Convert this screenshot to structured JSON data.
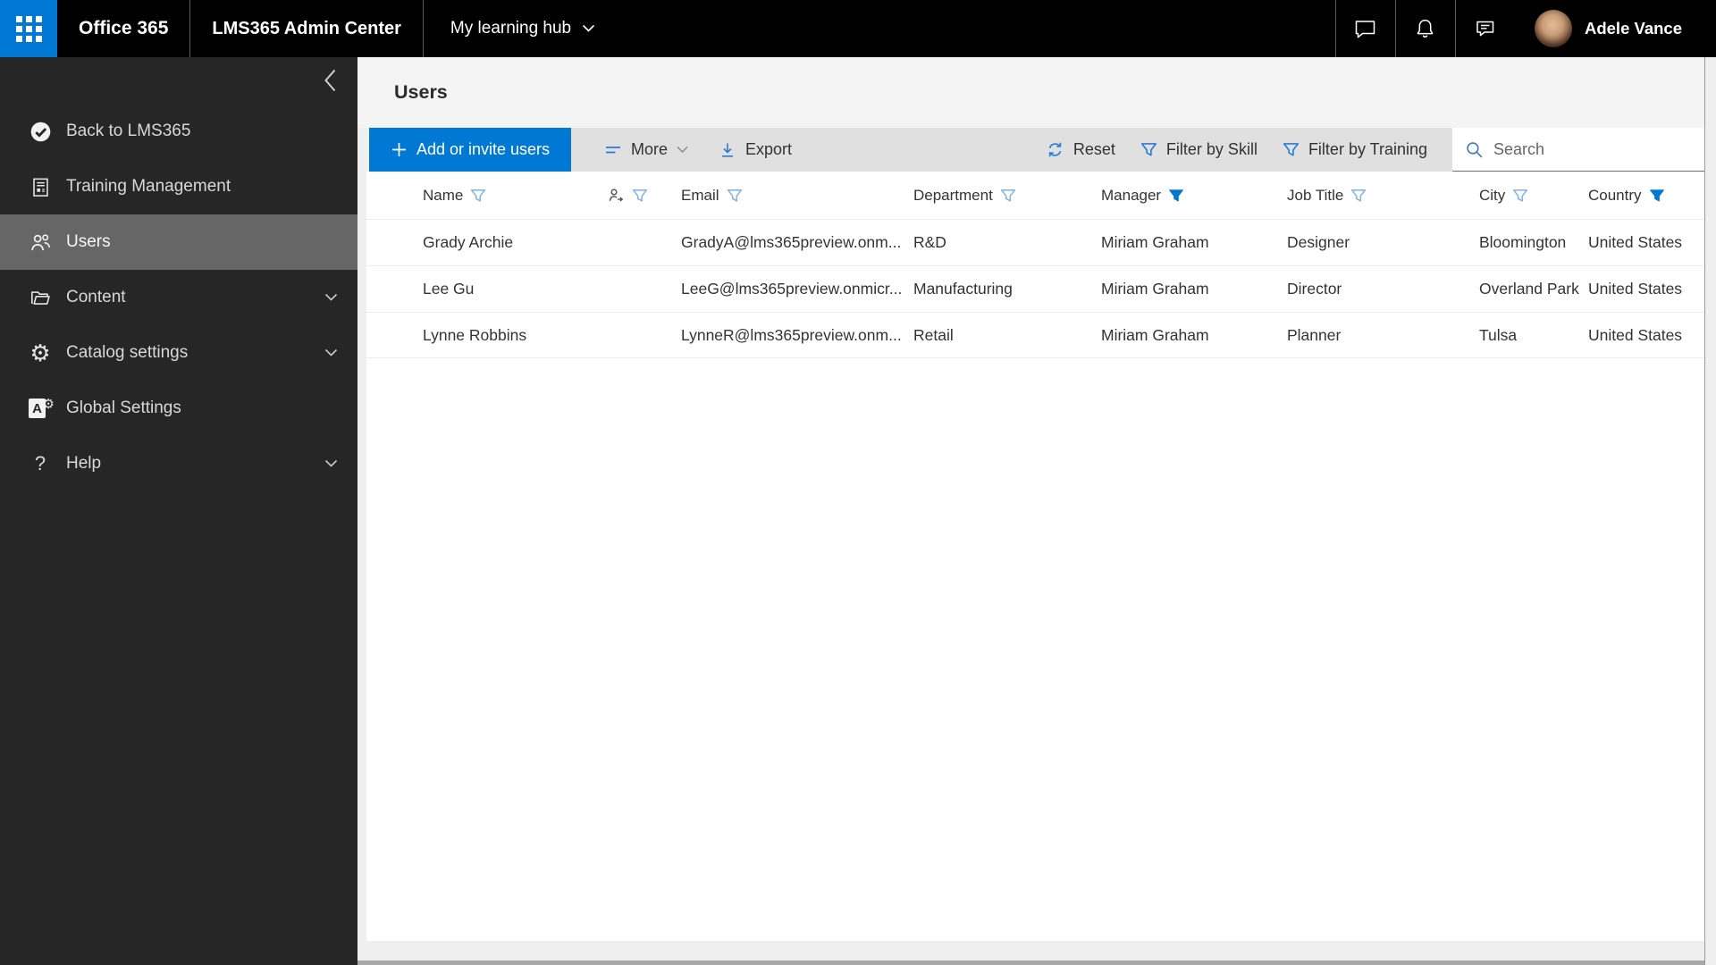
{
  "topbar": {
    "brand": "Office 365",
    "product": "LMS365 Admin Center",
    "hub_menu": "My learning hub",
    "user_name": "Adele Vance"
  },
  "sidebar": {
    "items": [
      {
        "label": "Back to LMS365",
        "icon": "lms365-logo",
        "expandable": false,
        "selected": false
      },
      {
        "label": "Training Management",
        "icon": "training-document",
        "expandable": false,
        "selected": false
      },
      {
        "label": "Users",
        "icon": "people",
        "expandable": false,
        "selected": true
      },
      {
        "label": "Content",
        "icon": "folder-open",
        "expandable": true,
        "selected": false
      },
      {
        "label": "Catalog settings",
        "icon": "gear",
        "expandable": true,
        "selected": false
      },
      {
        "label": "Global Settings",
        "icon": "admin-a-gear",
        "expandable": false,
        "selected": false
      },
      {
        "label": "Help",
        "icon": "question-mark",
        "expandable": true,
        "selected": false
      }
    ]
  },
  "page": {
    "title": "Users"
  },
  "toolbar": {
    "add_button_label": "Add or invite users",
    "more_label": "More",
    "export_label": "Export",
    "reset_label": "Reset",
    "filter_by_skill_label": "Filter by Skill",
    "filter_by_training_label": "Filter by Training",
    "search_placeholder": "Search"
  },
  "table": {
    "headers": [
      {
        "label": "Name",
        "filter": "outline"
      },
      {
        "label": "",
        "icon": "person-sync",
        "filter": "outline"
      },
      {
        "label": "Email",
        "filter": "outline"
      },
      {
        "label": "Department",
        "filter": "outline"
      },
      {
        "label": "Manager",
        "filter": "active"
      },
      {
        "label": "Job Title",
        "filter": "outline"
      },
      {
        "label": "City",
        "filter": "outline"
      },
      {
        "label": "Country",
        "filter": "active"
      }
    ],
    "rows": [
      {
        "name": "Grady Archie",
        "email": "GradyA@lms365preview.onm...",
        "department": "R&D",
        "manager": "Miriam Graham",
        "job_title": "Designer",
        "city": "Bloomington",
        "country": "United States"
      },
      {
        "name": "Lee Gu",
        "email": "LeeG@lms365preview.onmicr...",
        "department": "Manufacturing",
        "manager": "Miriam Graham",
        "job_title": "Director",
        "city": "Overland Park",
        "country": "United States"
      },
      {
        "name": "Lynne Robbins",
        "email": "LynneR@lms365preview.onm...",
        "department": "Retail",
        "manager": "Miriam Graham",
        "job_title": "Planner",
        "city": "Tulsa",
        "country": "United States"
      }
    ]
  },
  "icons": {
    "gear_glyph": "⚙",
    "question_glyph": "?",
    "global_letter": "A"
  },
  "colors": {
    "accent": "#0078d4",
    "topbar_bg": "#000000",
    "sidebar_bg": "#262626",
    "sidebar_selected": "#666666",
    "toolbar_bg": "#e0e0e0",
    "header_band": "#f4f4f4",
    "icon_blue": "#2b7cd3",
    "filter_active": "#0078d4"
  }
}
